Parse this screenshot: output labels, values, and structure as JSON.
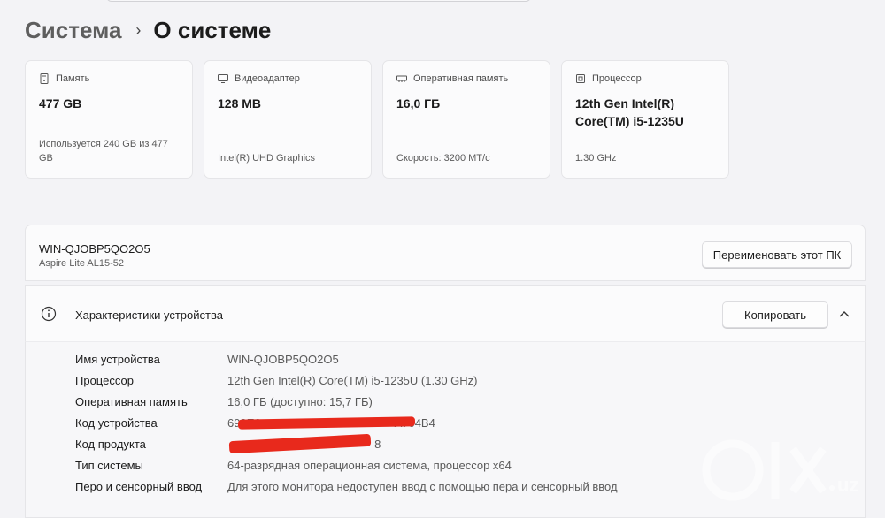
{
  "breadcrumb": {
    "parent": "Система",
    "separator": "›",
    "current": "О системе"
  },
  "cards": [
    {
      "icon": "storage-icon",
      "label": "Память",
      "value": "477 GB",
      "sub": "Используется 240 GB из 477 GB"
    },
    {
      "icon": "display-adapter-icon",
      "label": "Видеоадаптер",
      "value": "128 MB",
      "sub": "Intel(R) UHD Graphics"
    },
    {
      "icon": "ram-icon",
      "label": "Оперативная память",
      "value": "16,0 ГБ",
      "sub": "Скорость: 3200 MT/с"
    },
    {
      "icon": "processor-icon",
      "label": "Процессор",
      "value": "12th Gen Intel(R) Core(TM) i5-1235U",
      "sub": "1.30 GHz"
    }
  ],
  "pc": {
    "name": "WIN-QJOBP5QO2O5",
    "model": "Aspire Lite AL15-52",
    "rename_label": "Переименовать этот ПК"
  },
  "specs": {
    "title": "Характеристики устройства",
    "copy_label": "Копировать",
    "rows": [
      {
        "label": "Имя устройства",
        "value": "WIN-QJOBP5QO2O5"
      },
      {
        "label": "Процессор",
        "value": "12th Gen Intel(R) Core(TM) i5-1235U (1.30 GHz)"
      },
      {
        "label": "Оперативная память",
        "value": "16,0 ГБ (доступно: 15,7 ГБ)"
      },
      {
        "label": "Код устройства",
        "value": "699E6                                          A704B4"
      },
      {
        "label": "Код продукта",
        "value": "                                              8"
      },
      {
        "label": "Тип системы",
        "value": "64-разрядная операционная система, процессор x64"
      },
      {
        "label": "Перо и сенсорный ввод",
        "value": "Для этого монитора недоступен ввод с помощью пера и сенсорный ввод"
      }
    ]
  },
  "watermark": {
    "text": "OLX.uz"
  },
  "colors": {
    "redaction": "#e8291c",
    "background": "#f3f3f6",
    "card": "#fbfbfc"
  }
}
